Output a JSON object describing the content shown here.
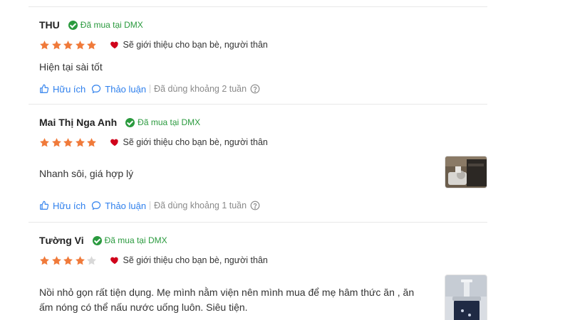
{
  "reviews": [
    {
      "name": "THU",
      "verified_label": "Đã mua tại DMX",
      "rating": 5,
      "recommend": "Sẽ giới thiệu cho bạn bè, người thân",
      "comment": "Hiện tại sài tốt",
      "helpful_label": "Hữu ích",
      "discuss_label": "Thảo luận",
      "usage": "Đã dùng khoảng 2 tuần",
      "has_photo": false
    },
    {
      "name": "Mai Thị Nga Anh",
      "verified_label": "Đã mua tại DMX",
      "rating": 5,
      "recommend": "Sẽ giới thiệu cho bạn bè, người thân",
      "comment": "Nhanh sôi, giá hợp lý",
      "helpful_label": "Hữu ích",
      "discuss_label": "Thảo luận",
      "usage": "Đã dùng khoảng 1 tuần",
      "has_photo": true
    },
    {
      "name": "Tường Vi",
      "verified_label": "Đã mua tại DMX",
      "rating": 4,
      "recommend": "Sẽ giới thiệu cho bạn bè, người thân",
      "comment_line1": "Nồi nhỏ gọn rất tiện dụng. Mẹ mình nằm viện nên mình mua để mẹ hâm thức ăn , ăn",
      "comment_line2": "ấm nóng có thể nấu nước uống luôn. Siêu tiện.",
      "has_photo": true
    }
  ],
  "colors": {
    "star_filled": "#f07a3a",
    "star_empty": "#d8d8d8",
    "heart": "#d0021b",
    "verified": "#2a9a3e",
    "link": "#2f80ed"
  }
}
